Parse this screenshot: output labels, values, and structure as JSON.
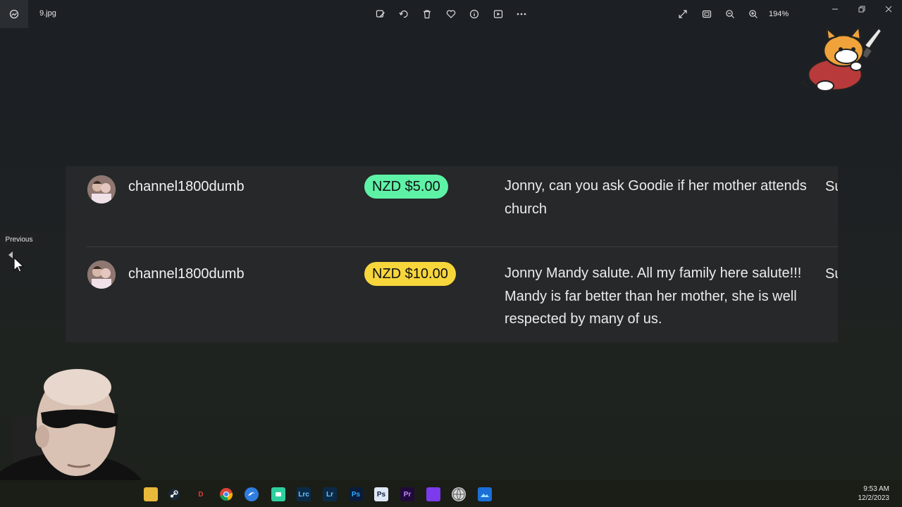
{
  "window": {
    "file_name": "9.jpg",
    "zoom": "194%"
  },
  "toolbar": {
    "icons": [
      "edit-image-icon",
      "rotate-icon",
      "delete-icon",
      "favorite-icon",
      "info-icon",
      "slideshow-icon",
      "more-icon"
    ],
    "right_icons": [
      "fullscreen-icon",
      "fit-window-icon",
      "zoom-out-icon",
      "zoom-in-icon"
    ]
  },
  "chat": {
    "rows": [
      {
        "username": "channel1800dumb",
        "amount": "NZD $5.00",
        "badge_color": "#5ef2a6",
        "message": "Jonny, can you ask Goodie if her mother attends church",
        "trail": "Su"
      },
      {
        "username": "channel1800dumb",
        "amount": "NZD $10.00",
        "badge_color": "#f7d63c",
        "message": "Jonny Mandy salute. All my family here salute!!! Mandy is far better than her mother, she is well respected by many of us.",
        "trail": "Su"
      }
    ]
  },
  "nav": {
    "previous_tooltip": "Previous"
  },
  "taskbar": {
    "apps": [
      "file-explorer",
      "steam",
      "d-app",
      "chrome",
      "edge-app",
      "green-app",
      "Lrc",
      "Lr",
      "Ps",
      "Ps-doc",
      "Pr",
      "purple-app",
      "globe-app",
      "photos-app"
    ],
    "time": "9:53 AM",
    "date": "12/2/2023"
  }
}
